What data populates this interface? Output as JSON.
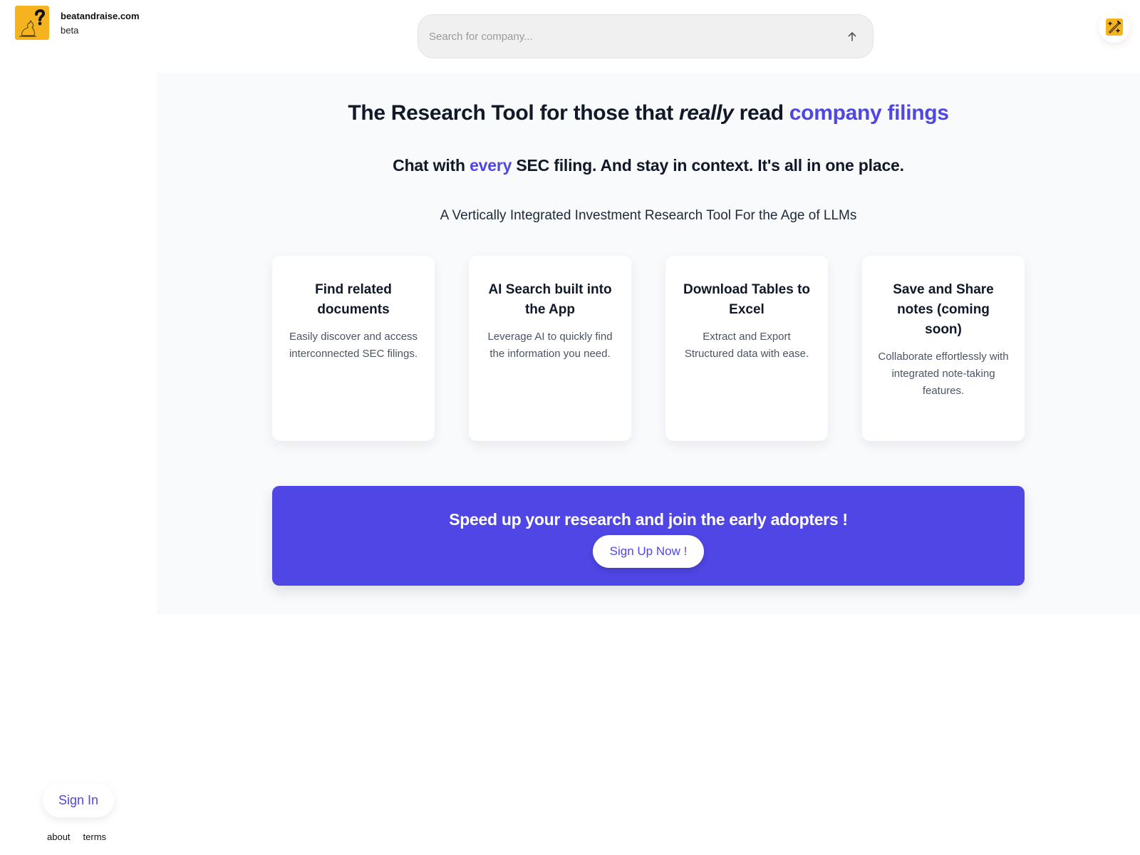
{
  "brand": {
    "name": "beatandraise.com",
    "tag": "beta",
    "logo_icon": "question-cat-logo",
    "logo_color": "#f5b31f"
  },
  "search": {
    "placeholder": "Search for company...",
    "value": "",
    "submit_icon": "arrow-up-icon"
  },
  "toolbar": {
    "wand_icon": "magic-wand-icon"
  },
  "hero": {
    "headline_part1": "The Research Tool for those that ",
    "headline_italic": "really",
    "headline_part2": " read ",
    "headline_accent": "company filings",
    "subhead_part1": "Chat with ",
    "subhead_accent": "every",
    "subhead_part2": " SEC filing. And stay in context. It's all in one place.",
    "tagline": "A Vertically Integrated Investment Research Tool For the Age of LLMs"
  },
  "features": [
    {
      "title": "Find related documents",
      "description": "Easily discover and access interconnected SEC filings."
    },
    {
      "title": "AI Search built into the App",
      "description": "Leverage AI to quickly find the information you need."
    },
    {
      "title": "Download Tables to Excel",
      "description": "Extract and Export Structured data with ease."
    },
    {
      "title": "Save and Share notes (coming soon)",
      "description": "Collaborate effortlessly with integrated note-taking features."
    }
  ],
  "cta": {
    "title": "Speed up your research and join the early adopters !",
    "button_label": "Sign Up Now !"
  },
  "auth": {
    "sign_in_label": "Sign In"
  },
  "footer": {
    "links": [
      "about",
      "terms"
    ]
  },
  "colors": {
    "accent": "#4f46e5",
    "brand_yellow": "#f5b31f",
    "panel_bg": "#f8fafc"
  }
}
